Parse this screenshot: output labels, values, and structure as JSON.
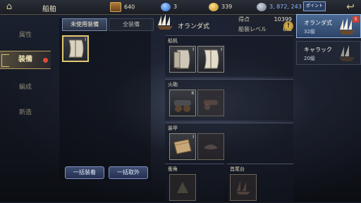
{
  "header": {
    "title": "船舶",
    "resources": [
      {
        "icon": "treasure-chest-icon",
        "value": "640"
      },
      {
        "icon": "gem-icon",
        "value": "3"
      },
      {
        "icon": "gold-coin-icon",
        "value": "339"
      },
      {
        "icon": "silver-coin-icon",
        "value": "3, 872, 243"
      }
    ]
  },
  "side_menu": {
    "items": [
      {
        "label": "属性"
      },
      {
        "label": "装備"
      },
      {
        "label": "編成"
      },
      {
        "label": "新造"
      }
    ]
  },
  "inventory": {
    "tabs": [
      {
        "label": "未使用装備"
      },
      {
        "label": "全装備"
      }
    ],
    "slot_mark": "I",
    "bulk_equip_label": "一括装着",
    "bulk_remove_label": "一括取外"
  },
  "ship": {
    "type": "オランダ式",
    "score_label": "得点",
    "score_value": "10399",
    "level_label": "船装レベル",
    "level_value": "0.8",
    "info_mark": "!"
  },
  "equipment": {
    "categories": [
      {
        "label": "船帆",
        "mark1": "I",
        "mark2": "I"
      },
      {
        "label": "火砲",
        "mark1": "II"
      },
      {
        "label": "装甲",
        "mark1": "I"
      }
    ],
    "sub_categories": [
      {
        "label": "衝角"
      },
      {
        "label": "首尾台"
      }
    ]
  },
  "ship_list": {
    "pointer_label": "ポイント",
    "badge": "5",
    "ships": [
      {
        "name": "オランダ式",
        "level": "32級"
      },
      {
        "name": "キャラック",
        "level": "20級"
      }
    ]
  },
  "colors": {
    "accent_gold": "#e3c870",
    "selected_blue": "#4a6a94",
    "alert_red": "#e04a3a"
  }
}
